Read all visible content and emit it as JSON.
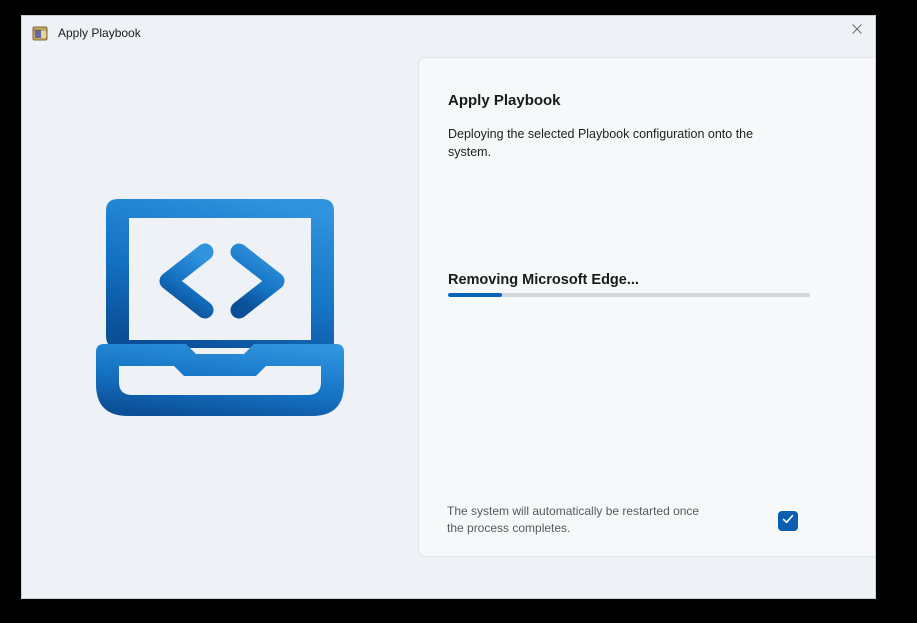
{
  "window": {
    "title": "Apply Playbook"
  },
  "panel": {
    "title": "Apply Playbook",
    "description": "Deploying the selected Playbook configuration onto the system.",
    "status": "Removing Microsoft Edge...",
    "progress": 0.15,
    "restart_note": "The system will automatically be restarted once the process completes.",
    "restart_checked": true
  },
  "icons": {
    "app": "app-package-icon",
    "close": "close-icon",
    "illustration": "laptop-code-icon",
    "check": "checkmark-icon"
  },
  "colors": {
    "accent": "#0a63b8",
    "window_bg": "#eef2f6",
    "panel_bg": "#f7f8fa",
    "track": "#d3d6da"
  }
}
